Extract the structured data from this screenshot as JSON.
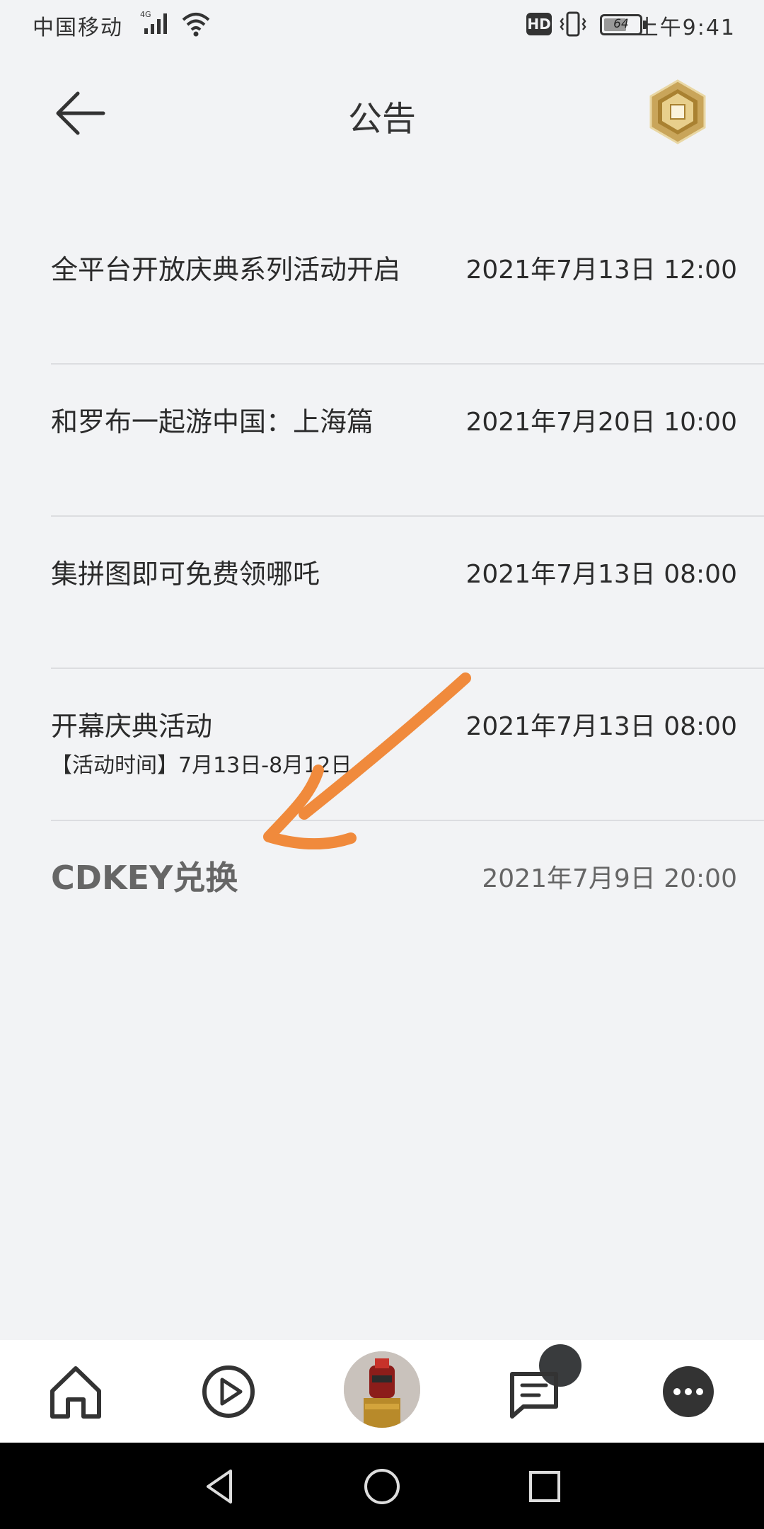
{
  "status_bar": {
    "carrier": "中国移动",
    "network": "4G",
    "hd_badge": "HD",
    "battery": "64",
    "battery_level": 0.64,
    "time": "上午9:41"
  },
  "header": {
    "title": "公告",
    "back_icon": "arrow-left-icon",
    "robux_icon": "robux-icon"
  },
  "announcements": [
    {
      "title": "全平台开放庆典系列活动开启",
      "subtitle": "",
      "date": "2021年7月13日 12:00"
    },
    {
      "title": "和罗布一起游中国：上海篇",
      "subtitle": "",
      "date": "2021年7月20日 10:00"
    },
    {
      "title": "集拼图即可免费领哪吒",
      "subtitle": "",
      "date": "2021年7月13日 08:00"
    },
    {
      "title": "开幕庆典活动",
      "subtitle": "【活动时间】7月13日-8月12日",
      "date": "2021年7月13日 08:00"
    },
    {
      "title": "CDKEY兑换",
      "subtitle": "",
      "date": "2021年7月9日 20:00"
    }
  ],
  "annotation": {
    "color": "#f08a3c"
  },
  "bottom_nav": {
    "items": [
      "home-icon",
      "play-icon",
      "avatar",
      "chat-icon",
      "more-icon"
    ]
  },
  "system_nav": {
    "items": [
      "back-triangle-icon",
      "home-circle-icon",
      "recents-square-icon"
    ]
  }
}
